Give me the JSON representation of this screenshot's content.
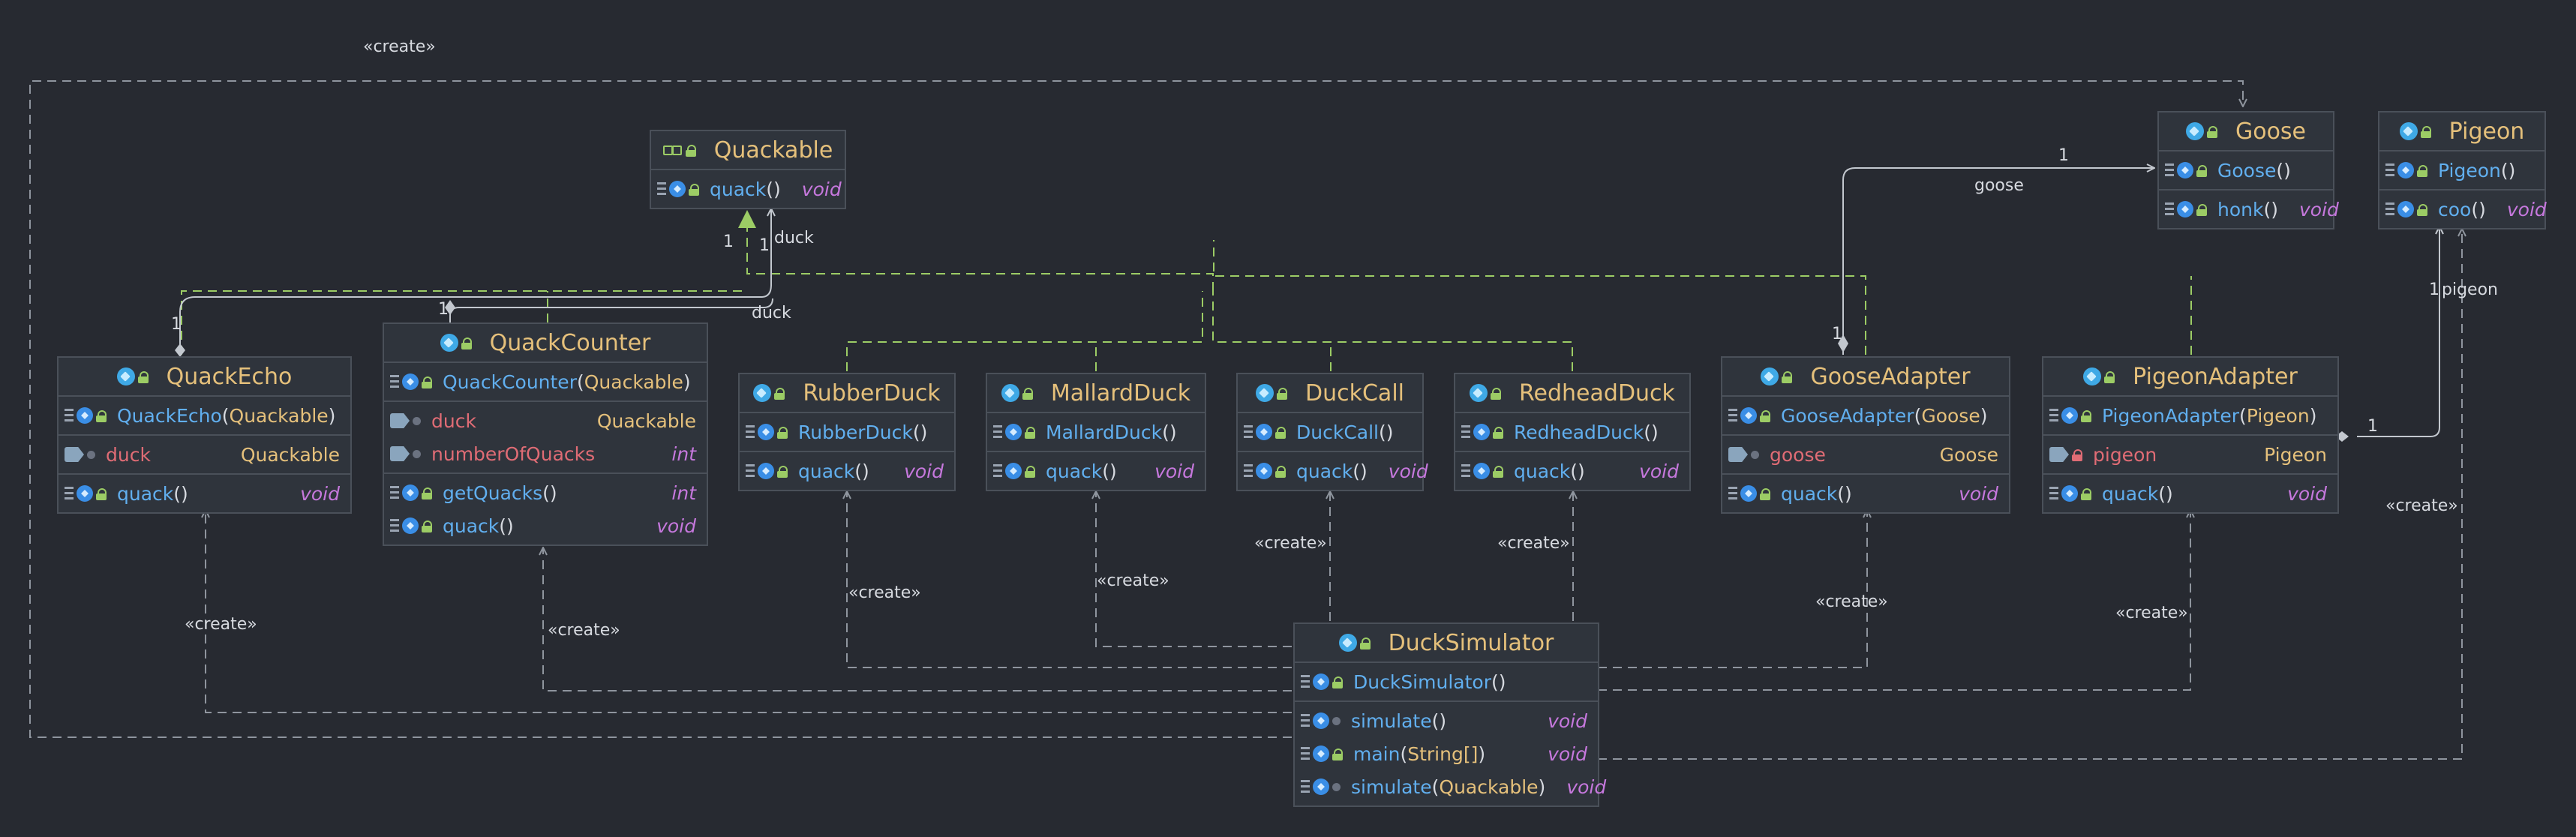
{
  "classes": {
    "quackable": {
      "name": "Quackable",
      "methods": [
        {
          "name": "quack",
          "params": "",
          "ret": "void"
        }
      ]
    },
    "quackecho": {
      "name": "QuackEcho",
      "ctor": {
        "name": "QuackEcho",
        "params": "Quackable"
      },
      "fields": [
        {
          "name": "duck",
          "type": "Quackable"
        }
      ],
      "methods": [
        {
          "name": "quack",
          "params": "",
          "ret": "void"
        }
      ]
    },
    "quackcounter": {
      "name": "QuackCounter",
      "ctor": {
        "name": "QuackCounter",
        "params": "Quackable"
      },
      "fields": [
        {
          "name": "duck",
          "type": "Quackable"
        },
        {
          "name": "numberOfQuacks",
          "type": "int"
        }
      ],
      "methods": [
        {
          "name": "getQuacks",
          "params": "",
          "ret": "int"
        },
        {
          "name": "quack",
          "params": "",
          "ret": "void"
        }
      ]
    },
    "rubberduck": {
      "name": "RubberDuck",
      "ctor": {
        "name": "RubberDuck",
        "params": ""
      },
      "methods": [
        {
          "name": "quack",
          "params": "",
          "ret": "void"
        }
      ]
    },
    "mallardduck": {
      "name": "MallardDuck",
      "ctor": {
        "name": "MallardDuck",
        "params": ""
      },
      "methods": [
        {
          "name": "quack",
          "params": "",
          "ret": "void"
        }
      ]
    },
    "duckcall": {
      "name": "DuckCall",
      "ctor": {
        "name": "DuckCall",
        "params": ""
      },
      "methods": [
        {
          "name": "quack",
          "params": "",
          "ret": "void"
        }
      ]
    },
    "redheadduck": {
      "name": "RedheadDuck",
      "ctor": {
        "name": "RedheadDuck",
        "params": ""
      },
      "methods": [
        {
          "name": "quack",
          "params": "",
          "ret": "void"
        }
      ]
    },
    "gooseadapter": {
      "name": "GooseAdapter",
      "ctor": {
        "name": "GooseAdapter",
        "params": "Goose"
      },
      "fields": [
        {
          "name": "goose",
          "type": "Goose"
        }
      ],
      "methods": [
        {
          "name": "quack",
          "params": "",
          "ret": "void"
        }
      ]
    },
    "pigeonadapter": {
      "name": "PigeonAdapter",
      "ctor": {
        "name": "PigeonAdapter",
        "params": "Pigeon"
      },
      "fields": [
        {
          "name": "pigeon",
          "type": "Pigeon"
        }
      ],
      "methods": [
        {
          "name": "quack",
          "params": "",
          "ret": "void"
        }
      ]
    },
    "goose": {
      "name": "Goose",
      "ctor": {
        "name": "Goose",
        "params": ""
      },
      "methods": [
        {
          "name": "honk",
          "params": "",
          "ret": "void"
        }
      ]
    },
    "pigeon": {
      "name": "Pigeon",
      "ctor": {
        "name": "Pigeon",
        "params": ""
      },
      "methods": [
        {
          "name": "coo",
          "params": "",
          "ret": "void"
        }
      ]
    },
    "ducksimulator": {
      "name": "DuckSimulator",
      "ctor": {
        "name": "DuckSimulator",
        "params": ""
      },
      "methods": [
        {
          "name": "simulate",
          "params": "",
          "ret": "void"
        },
        {
          "name": "main",
          "params": "String[]",
          "ret": "void"
        },
        {
          "name": "simulate",
          "params": "Quackable",
          "ret": "void"
        }
      ]
    }
  },
  "labels": {
    "create": "«create»",
    "duck": "duck",
    "goose": "goose",
    "pigeon": "pigeon",
    "one": "1"
  },
  "colors": {
    "background": "#272a31",
    "create_edge": "#8f959e",
    "realization_edge": "#9ccc65",
    "association_edge": "#c3c8cf"
  }
}
